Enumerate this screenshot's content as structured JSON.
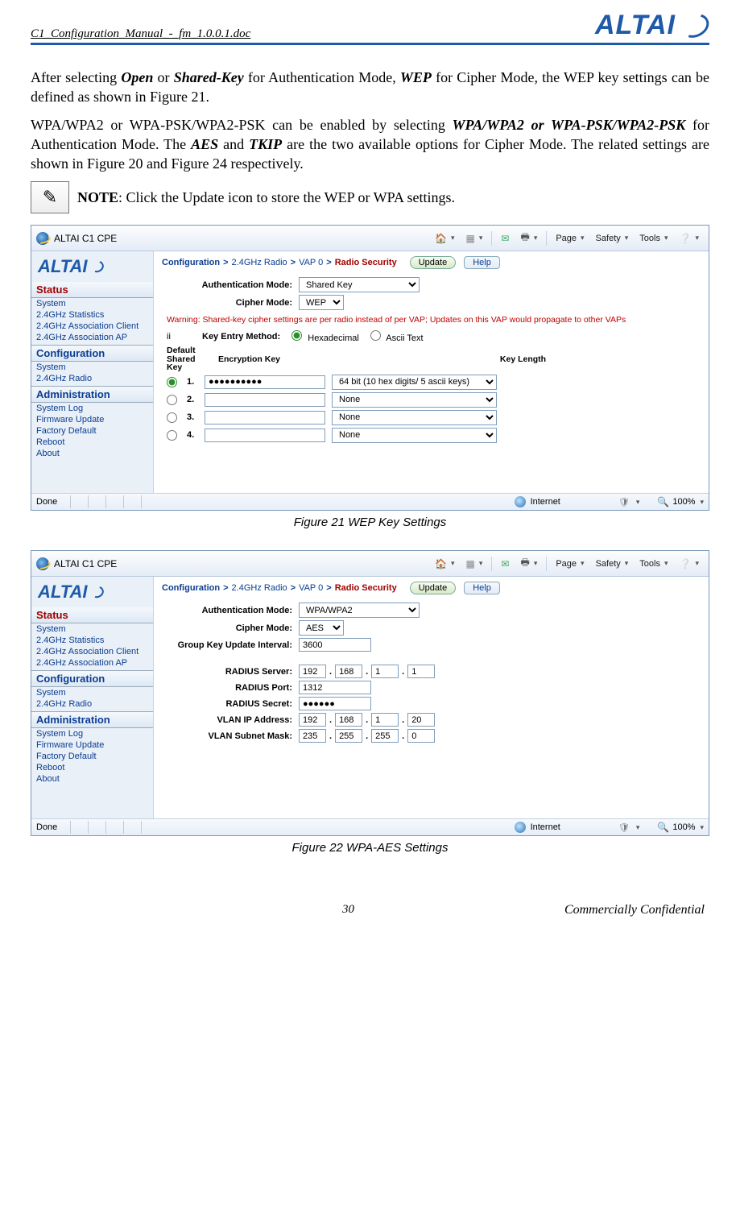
{
  "header": {
    "doc_title": "C1_Configuration_Manual_-_fm_1.0.0.1.doc",
    "brand": "ALTAI"
  },
  "body": {
    "para1_a": "After selecting ",
    "para1_open": "Open",
    "para1_b": " or ",
    "para1_shared": "Shared-Key",
    "para1_c": " for Authentication Mode, ",
    "para1_wep": "WEP",
    "para1_d": " for Cipher Mode, the WEP key settings can be defined as shown in Figure 21.",
    "para2_a": "WPA/WPA2 or WPA-PSK/WPA2-PSK can be enabled by selecting ",
    "para2_b1": "WPA/WPA2 or WPA-PSK/WPA2-PSK",
    "para2_c": " for Authentication Mode. The ",
    "para2_aes": "AES",
    "para2_d": " and ",
    "para2_tkip": "TKIP",
    "para2_e": " are the two available options for Cipher Mode. The related settings are shown in Figure 20 and Figure 24 respectively.",
    "note_strong": "NOTE",
    "note_rest": ": Click the ",
    "note_update": "Update",
    "note_tail": " icon to store the WEP or WPA settings."
  },
  "toolbar": {
    "title": "ALTAI C1 CPE",
    "page": "Page",
    "safety": "Safety",
    "tools": "Tools"
  },
  "sidebar": {
    "brand": "ALTAI",
    "status": "Status",
    "status_items": [
      "System",
      "2.4GHz Statistics",
      "2.4GHz Association Client",
      "2.4GHz Association AP"
    ],
    "config": "Configuration",
    "config_items": [
      "System",
      "2.4GHz Radio"
    ],
    "admin": "Administration",
    "admin_items": [
      "System Log",
      "Firmware Update",
      "Factory Default",
      "Reboot",
      "About"
    ]
  },
  "crumb": {
    "c1": "Configuration",
    "c2": "2.4GHz Radio",
    "c3": "VAP 0",
    "c4": "Radio Security",
    "gt": ">",
    "update": "Update",
    "help": "Help"
  },
  "fig1": {
    "auth_label": "Authentication Mode:",
    "auth_value": "Shared Key",
    "cipher_label": "Cipher Mode:",
    "cipher_value": "WEP",
    "warning": "Warning: Shared-key cipher settings are per radio instead of per VAP; Updates on this VAP would propagate to other VAPs",
    "ii": "ii",
    "entry_label": "Key Entry Method:",
    "entry_hex": "Hexadecimal",
    "entry_ascii": "Ascii Text",
    "col_default": "Default Shared Key",
    "col_enc": "Encryption Key",
    "col_len": "Key Length",
    "rows": [
      {
        "n": "1.",
        "val": "●●●●●●●●●●",
        "len": "64 bit (10 hex digits/ 5 ascii keys)"
      },
      {
        "n": "2.",
        "val": "",
        "len": "None"
      },
      {
        "n": "3.",
        "val": "",
        "len": "None"
      },
      {
        "n": "4.",
        "val": "",
        "len": "None"
      }
    ],
    "caption": "Figure 21    WEP Key Settings"
  },
  "fig2": {
    "auth_label": "Authentication Mode:",
    "auth_value": "WPA/WPA2",
    "cipher_label": "Cipher Mode:",
    "cipher_value": "AES",
    "group_label": "Group Key Update Interval:",
    "group_value": "3600",
    "radius_server_label": "RADIUS Server:",
    "radius_server": [
      "192",
      "168",
      "1",
      "1"
    ],
    "radius_port_label": "RADIUS Port:",
    "radius_port": "1312",
    "radius_secret_label": "RADIUS Secret:",
    "radius_secret": "●●●●●●",
    "vlan_ip_label": "VLAN IP Address:",
    "vlan_ip": [
      "192",
      "168",
      "1",
      "20"
    ],
    "vlan_mask_label": "VLAN Subnet Mask:",
    "vlan_mask": [
      "235",
      "255",
      "255",
      "0"
    ],
    "caption": "Figure 22    WPA-AES Settings"
  },
  "status": {
    "done": "Done",
    "internet": "Internet",
    "zoom": "100%"
  },
  "footer": {
    "page": "30",
    "cc": "Commercially Confidential"
  }
}
